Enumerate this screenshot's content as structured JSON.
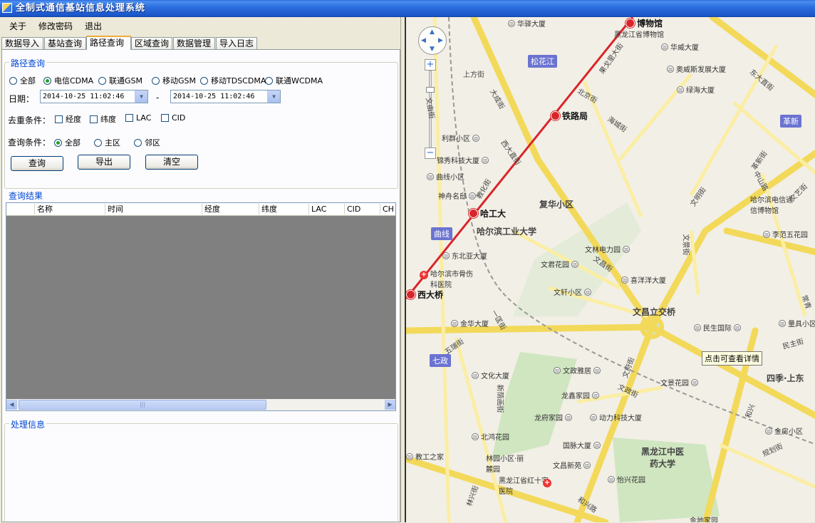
{
  "window": {
    "title": "全制式通信基站信息处理系统"
  },
  "menu": [
    "关于",
    "修改密码",
    "退出"
  ],
  "tabs": [
    "数据导入",
    "基站查询",
    "路径查询",
    "区域查询",
    "数据管理",
    "导入日志"
  ],
  "route_query": {
    "group_title": "路径查询",
    "network_options": [
      "全部",
      "电信CDMA",
      "联通GSM",
      "移动GSM",
      "移动TDSCDMA",
      "联通WCDMA"
    ],
    "network_selected": "电信CDMA",
    "date_label": "日期：",
    "date_from": "2014-10-25 11:02:46",
    "date_separator": "-",
    "date_to": "2014-10-25 11:02:46",
    "dedup_label": "去重条件：",
    "dedup_options": [
      "经度",
      "纬度",
      "LAC",
      "CID"
    ],
    "query_label": "查询条件：",
    "query_options": [
      "全部",
      "主区",
      "邻区"
    ],
    "query_selected": "全部",
    "buttons": {
      "query": "查询",
      "export": "导出",
      "clear": "清空"
    }
  },
  "results": {
    "group_title": "查询结果",
    "columns": [
      "名称",
      "时间",
      "经度",
      "纬度",
      "LAC",
      "CID",
      "CH"
    ]
  },
  "processing": {
    "group_title": "处理信息"
  },
  "map": {
    "tooltip": "点击可查看详情",
    "metro_stations": [
      "博物馆",
      "铁路局",
      "哈工大",
      "西大桥"
    ],
    "badges": [
      "松花江",
      "曲线",
      "七政",
      "革新"
    ],
    "pois": [
      "华驿大厦",
      "黑龙江省博物馆",
      "华威大厦",
      "奥威斯发展大厦",
      "绿海大厦",
      "利群小区",
      "锦秀科技大厦",
      "曲线小区",
      "神舟名邸",
      "东北亚大厦",
      "哈尔滨市骨伤科医院",
      "文林电力园",
      "文君花园",
      "喜洋洋大厦",
      "文轩小区",
      "金华大厦",
      "民生国际",
      "量具小区",
      "哈尔滨电信通信博物馆",
      "李范五花园",
      "文化大厦",
      "文政雅居",
      "龙鑫家园",
      "龙府家园",
      "动力科技大厦",
      "文景花园",
      "北鸿花园",
      "国脉大厦",
      "教工之家",
      "林园小区·丽麓园",
      "文昌新苑",
      "黑龙江省红十字医院",
      "怡兴花园",
      "金房小区",
      "金地家园"
    ],
    "area_labels": [
      "复华小区",
      "哈尔滨工业大学",
      "文昌立交桥",
      "黑龙江中医药大学",
      "四季·上东"
    ],
    "streets": [
      "上方街",
      "大成街",
      "北京街",
      "海城街",
      "西大直街",
      "教化街",
      "文昌街",
      "文景街",
      "文政街",
      "一匡街",
      "五瑞街",
      "新荫画街",
      "和兴路",
      "文府街",
      "规划街",
      "革新街",
      "中山路",
      "东大直街",
      "民主街",
      "文明街",
      "林兴街",
      "文由街",
      "和兴",
      "果戈里大街",
      "文艺街",
      "常青"
    ]
  }
}
